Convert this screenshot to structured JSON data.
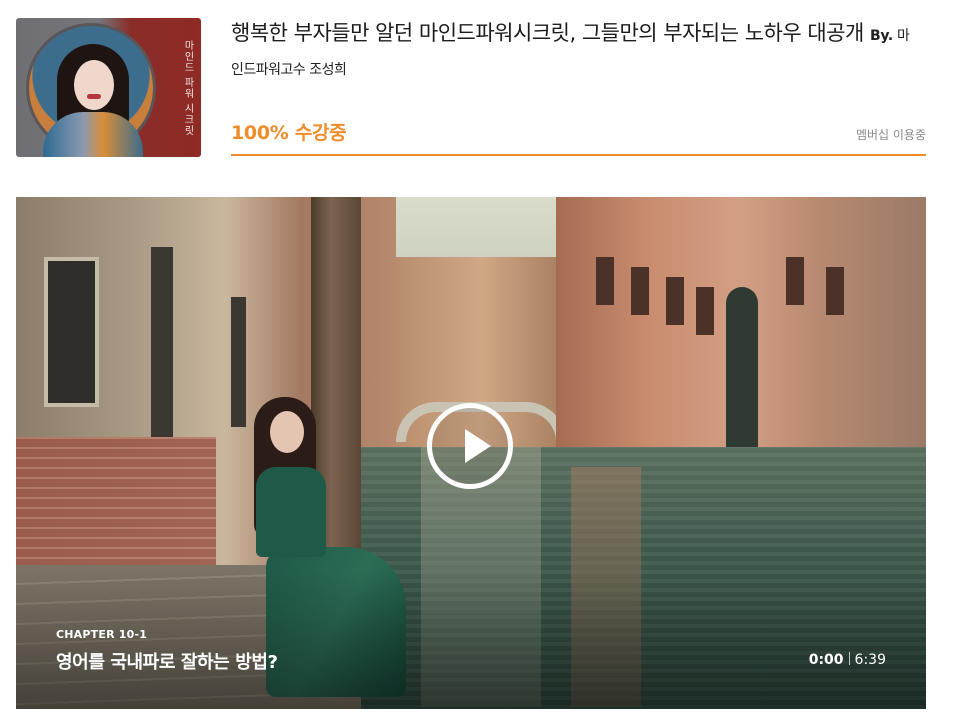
{
  "course": {
    "thumbnail_caption": "마인드 파워 시크릿",
    "title": "행복한 부자들만 알던 마인드파워시크릿, 그들만의 부자되는 노하우 대공개",
    "by_label": "By.",
    "instructor": "마인드파워고수 조성희",
    "progress_text": "100% 수강중",
    "progress_percent": 100,
    "membership_label": "멤버십 이용중"
  },
  "player": {
    "chapter": "CHAPTER 10-1",
    "lesson_title": "영어를 국내파로 잘하는 방법?",
    "current_time": "0:00",
    "duration": "6:39"
  },
  "colors": {
    "accent": "#f08c28"
  }
}
